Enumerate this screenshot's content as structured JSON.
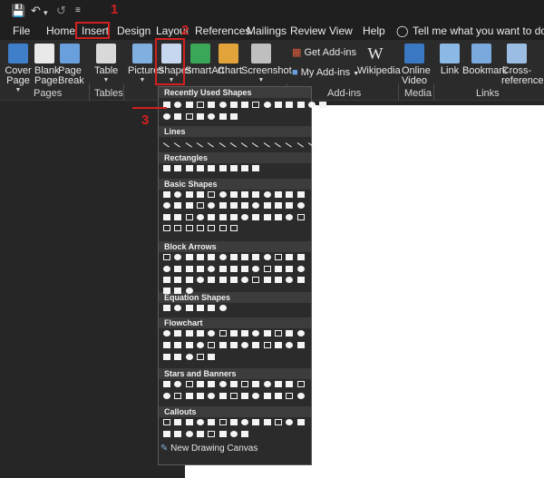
{
  "tabs": [
    "File",
    "Home",
    "Insert",
    "Design",
    "Layout",
    "References",
    "Mailings",
    "Review",
    "View",
    "Help"
  ],
  "tell_me": "Tell me what you want to do",
  "ribbon": {
    "cover_page": "Cover Page",
    "blank_page": "Blank Page",
    "page_break": "Page Break",
    "table": "Table",
    "pictures": "Pictures",
    "shapes": "Shapes",
    "smartart": "SmartArt",
    "chart": "Chart",
    "screenshot": "Screenshot",
    "get_addins": "Get Add-ins",
    "my_addins": "My Add-ins",
    "wikipedia": "Wikipedia",
    "online_video": "Online Video",
    "link": "Link",
    "bookmark": "Bookmark",
    "cross_reference": "Cross-reference",
    "groups": {
      "pages": "Pages",
      "tables": "Tables",
      "addins": "Add-ins",
      "media": "Media",
      "links": "Links"
    }
  },
  "shapes_menu": {
    "sections": [
      "Recently Used Shapes",
      "Lines",
      "Rectangles",
      "Basic Shapes",
      "Block Arrows",
      "Equation Shapes",
      "Flowchart",
      "Stars and Banners",
      "Callouts"
    ],
    "new_canvas": "New Drawing Canvas"
  },
  "annotations": {
    "step1": "1",
    "step2": "2",
    "step3": "3"
  },
  "colors": {
    "accent_red": "#d32020",
    "dark_bg": "#262626",
    "ribbon_bg": "#2b2b2b",
    "page": "#ffffff"
  }
}
